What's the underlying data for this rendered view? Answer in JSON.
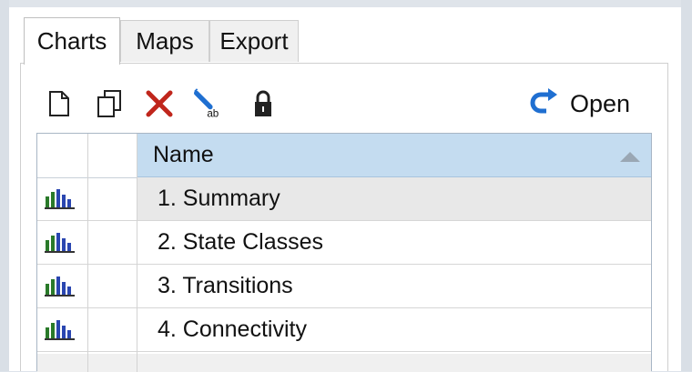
{
  "tabs": [
    {
      "label": "Charts",
      "active": true
    },
    {
      "label": "Maps",
      "active": false
    },
    {
      "label": "Export",
      "active": false
    }
  ],
  "toolbar": {
    "icons": [
      "new-document-icon",
      "copy-icon",
      "delete-icon",
      "rename-icon",
      "lock-icon"
    ],
    "open_label": "Open",
    "open_icon": "redo-arrow-icon"
  },
  "grid": {
    "column_header": "Name",
    "sort": "ascending",
    "rows": [
      {
        "name": "1. Summary",
        "selected": true,
        "icon": "bar-chart-icon"
      },
      {
        "name": "2. State Classes",
        "selected": false,
        "icon": "bar-chart-icon"
      },
      {
        "name": "3. Transitions",
        "selected": false,
        "icon": "bar-chart-icon"
      },
      {
        "name": "4. Connectivity",
        "selected": false,
        "icon": "bar-chart-icon"
      }
    ]
  },
  "colors": {
    "header_bg": "#c4dcf0",
    "selected_row_bg": "#e8e8e8",
    "delete_red": "#c0261c",
    "open_blue": "#1f6fd1"
  }
}
